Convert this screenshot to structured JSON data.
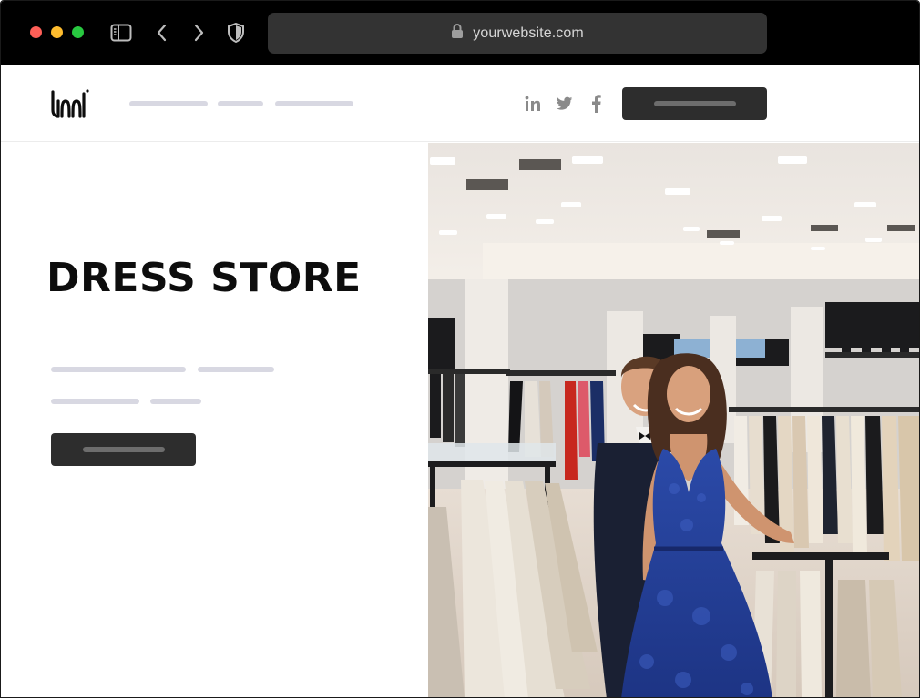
{
  "browser": {
    "url": "yourwebsite.com",
    "traffic_lights": {
      "close": "#fe5f57",
      "minimize": "#febc2e",
      "zoom": "#28c840"
    },
    "icons": [
      "sidebar-toggle-icon",
      "back-arrow-icon",
      "forward-arrow-icon",
      "shield-icon",
      "lock-icon"
    ]
  },
  "site": {
    "logo_icon": "brand-logo-icon",
    "social": [
      "linkedin-icon",
      "twitter-icon",
      "facebook-icon"
    ],
    "colors": {
      "button": "#2d2d2d",
      "placeholder_line": "#d8d8e2",
      "title": "#0d0d0d"
    }
  },
  "hero": {
    "title": "DRESS STORE",
    "image": "photo-of-couple-in-formal-dress-store"
  }
}
